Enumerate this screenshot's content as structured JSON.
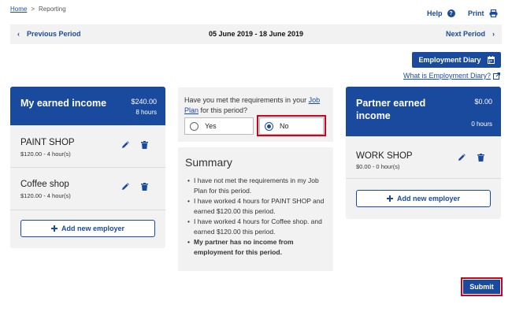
{
  "breadcrumb": {
    "home": "Home",
    "separator": ">",
    "current": "Reporting"
  },
  "header": {
    "help": "Help",
    "print": "Print"
  },
  "period": {
    "previous": "Previous Period",
    "range": "05 June 2019 - 18 June 2019",
    "next": "Next Period"
  },
  "diary": {
    "button": "Employment Diary",
    "link": "What is Employment Diary?"
  },
  "my_income": {
    "title": "My earned income",
    "amount": "$240.00",
    "hours": "8 hours",
    "employers": [
      {
        "name": "PAINT SHOP",
        "detail": "$120.00 - 4 hour(s)"
      },
      {
        "name": "Coffee shop",
        "detail": "$120.00 - 4 hour(s)"
      }
    ],
    "add_label": "Add new employer"
  },
  "question": {
    "text_before": "Have you met the requirements in your ",
    "link_text": "Job Plan",
    "text_after": " for this period?",
    "options": [
      "Yes",
      "No"
    ],
    "selected": "No"
  },
  "summary": {
    "title": "Summary",
    "items": [
      "I have not met the requirements in my Job Plan for this period.",
      "I have worked 4 hours for PAINT SHOP and earned $120.00 this period.",
      "I have worked 4 hours for Coffee shop. and earned $120.00 this period.",
      "My partner has no income from employment for this period."
    ]
  },
  "partner_income": {
    "title": "Partner earned income",
    "amount": "$0.00",
    "hours": "0 hours",
    "employers": [
      {
        "name": "WORK SHOP",
        "detail": "$0.00 - 0 hour(s)"
      }
    ],
    "add_label": "Add new employer"
  },
  "submit": "Submit",
  "colors": {
    "primary": "#1a4a9e",
    "highlight": "#d0021b",
    "panel": "#f2f2f2"
  }
}
